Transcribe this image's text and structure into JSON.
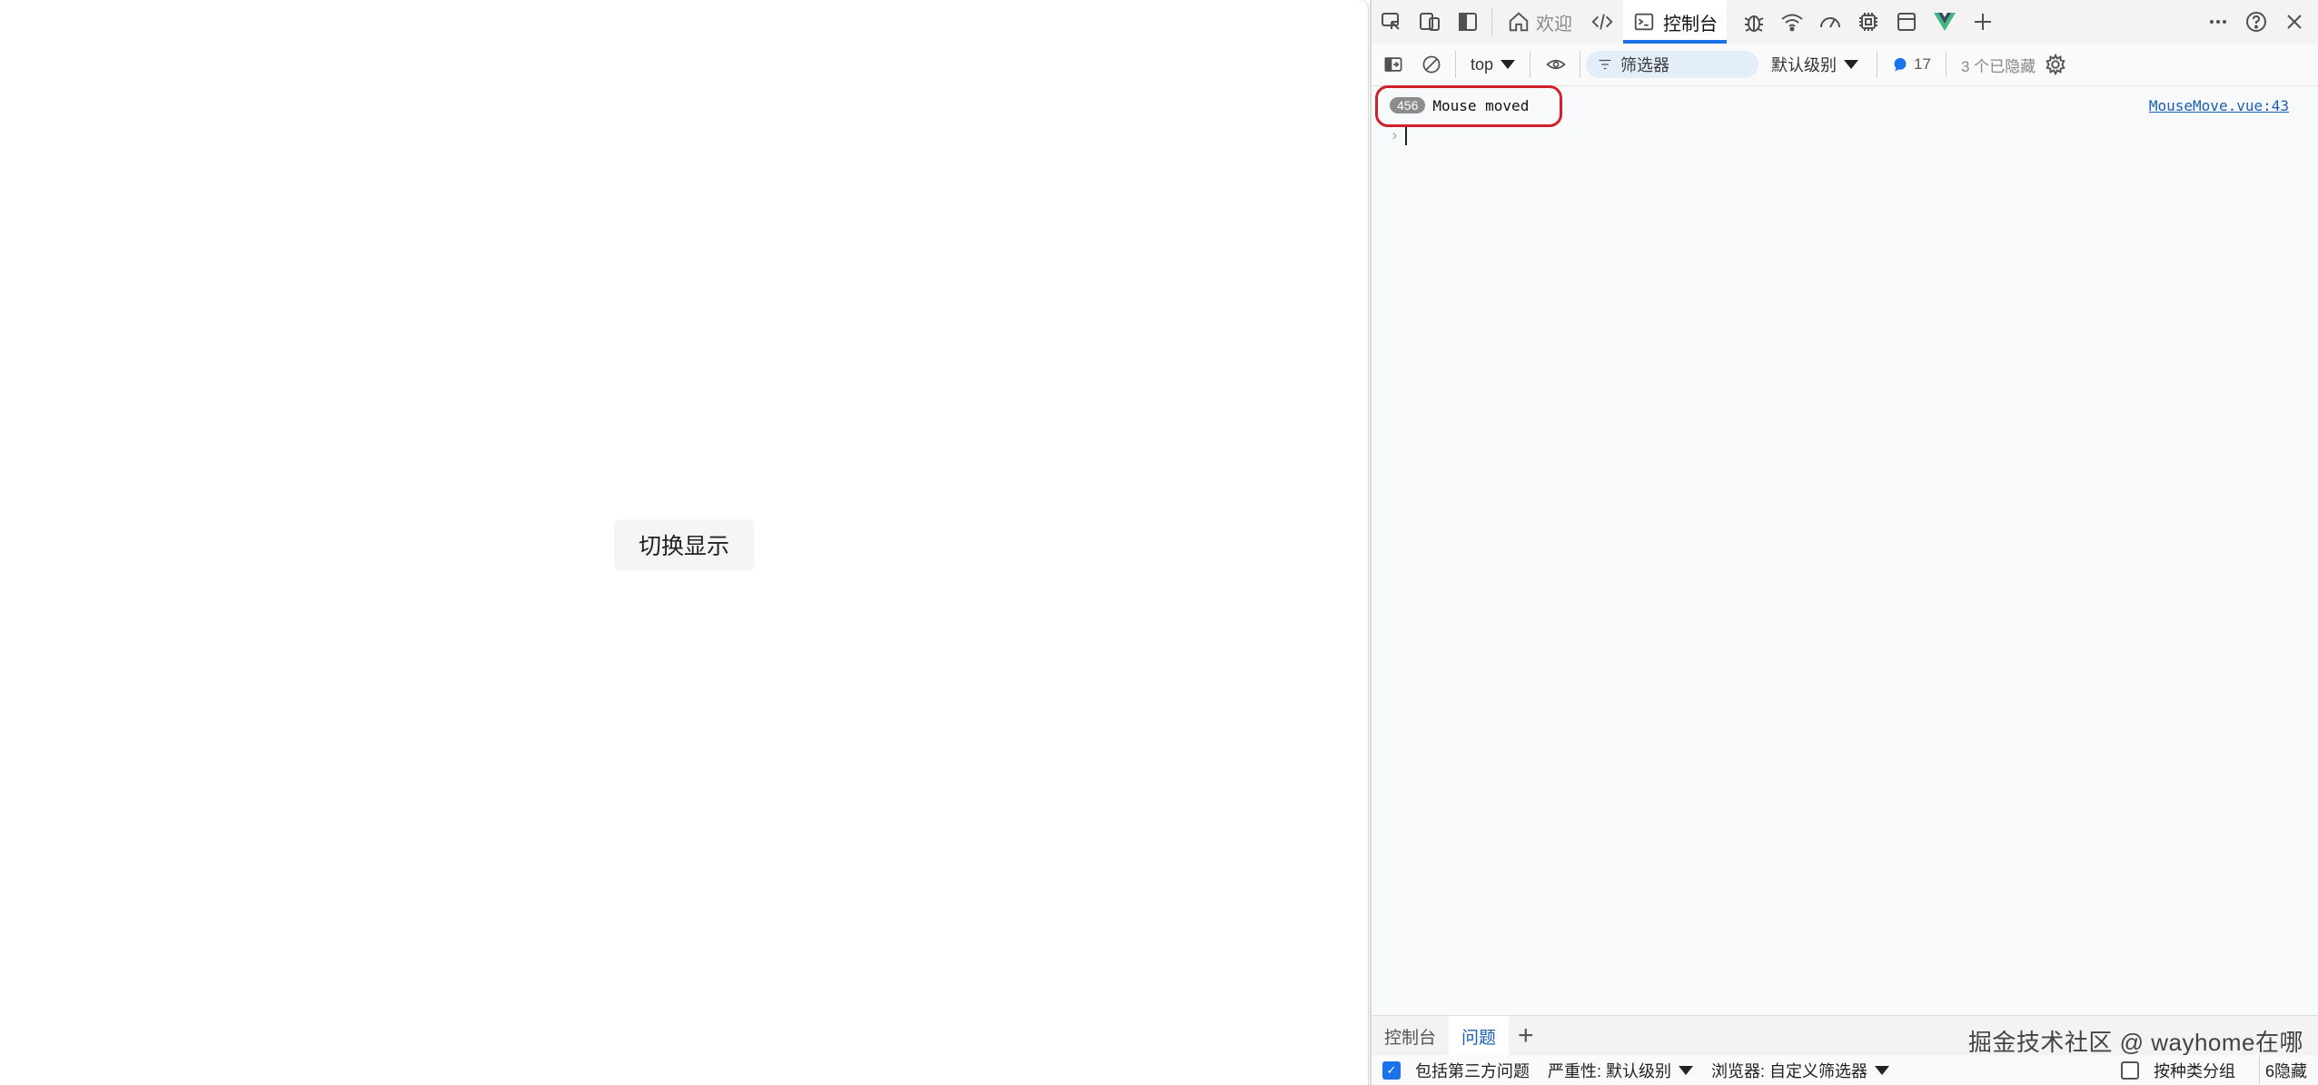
{
  "page": {
    "toggle_button": "切换显示"
  },
  "devtools": {
    "tabs": {
      "welcome": "欢迎",
      "console": "控制台"
    },
    "toolbar": {
      "context": "top",
      "filter_placeholder": "筛选器",
      "level": "默认级别",
      "message_count": "17",
      "hidden": "3 个已隐藏"
    },
    "log": {
      "repeat_count": "456",
      "message": "Mouse moved",
      "source": "MouseMove.vue:43"
    },
    "drawer": {
      "tab_console": "控制台",
      "tab_issues": "问题",
      "watermark": "掘金技术社区 @ wayhome在哪"
    },
    "issues": {
      "include_third_party": "包括第三方问题",
      "severity": "严重性: 默认级别",
      "browser": "浏览器: 自定义筛选器",
      "group_by_kind": "按种类分组",
      "hidden": "6隐藏"
    }
  },
  "colors": {
    "accent": "#1a73e8",
    "highlight": "#d0202a",
    "vue_green": "#41b883"
  }
}
